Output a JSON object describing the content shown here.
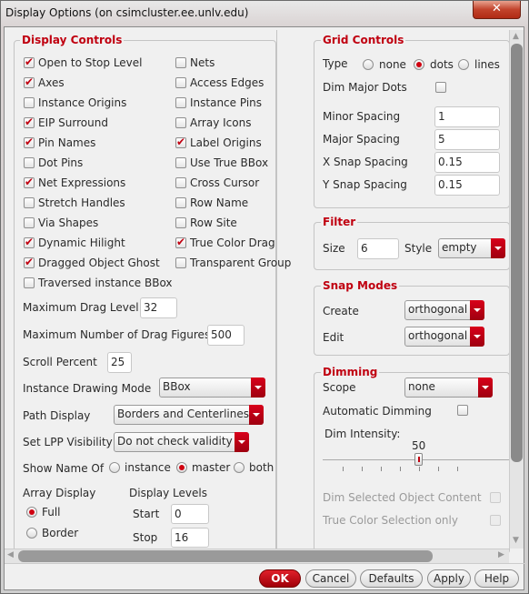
{
  "window": {
    "title": "Display Options (on csimcluster.ee.unlv.edu)",
    "close_icon": "close-icon"
  },
  "display_controls": {
    "title": "Display Controls",
    "left": [
      {
        "label": "Open to Stop Level",
        "checked": true
      },
      {
        "label": "Axes",
        "checked": true
      },
      {
        "label": "Instance Origins",
        "checked": false
      },
      {
        "label": "EIP Surround",
        "checked": true
      },
      {
        "label": "Pin Names",
        "checked": true
      },
      {
        "label": "Dot Pins",
        "checked": false
      },
      {
        "label": "Net Expressions",
        "checked": true
      },
      {
        "label": "Stretch Handles",
        "checked": false
      },
      {
        "label": "Via Shapes",
        "checked": false
      },
      {
        "label": "Dynamic Hilight",
        "checked": true
      },
      {
        "label": "Dragged Object Ghost",
        "checked": true
      },
      {
        "label": "Traversed instance BBox",
        "checked": false
      }
    ],
    "right": [
      {
        "label": "Nets",
        "checked": false
      },
      {
        "label": "Access Edges",
        "checked": false
      },
      {
        "label": "Instance Pins",
        "checked": false
      },
      {
        "label": "Array Icons",
        "checked": false
      },
      {
        "label": "Label Origins",
        "checked": true
      },
      {
        "label": "Use True BBox",
        "checked": false
      },
      {
        "label": "Cross Cursor",
        "checked": false
      },
      {
        "label": "Row Name",
        "checked": false
      },
      {
        "label": "Row Site",
        "checked": false
      },
      {
        "label": "True Color Drag",
        "checked": true
      },
      {
        "label": "Transparent Group",
        "checked": false
      }
    ],
    "max_drag_level": {
      "label": "Maximum Drag Level",
      "value": "32"
    },
    "max_drag_figures": {
      "label": "Maximum Number of Drag Figures",
      "value": "500"
    },
    "scroll_percent": {
      "label": "Scroll Percent",
      "value": "25"
    },
    "instance_drawing_mode": {
      "label": "Instance Drawing Mode",
      "value": "BBox"
    },
    "path_display": {
      "label": "Path Display",
      "value": "Borders and Centerlines"
    },
    "lpp_visibility": {
      "label": "Set LPP Visibility",
      "value": "Do not check validity"
    },
    "show_name_of": {
      "label": "Show Name Of",
      "options": [
        "instance",
        "master",
        "both"
      ],
      "selected": "master"
    },
    "array_display": {
      "label": "Array Display",
      "options": [
        "Full",
        "Border"
      ],
      "selected": "Full"
    },
    "display_levels": {
      "label": "Display Levels",
      "start_label": "Start",
      "start": "0",
      "stop_label": "Stop",
      "stop": "16"
    }
  },
  "grid_controls": {
    "title": "Grid Controls",
    "type_label": "Type",
    "type_options": [
      "none",
      "dots",
      "lines"
    ],
    "type_selected": "dots",
    "dim_major_dots": {
      "label": "Dim Major Dots",
      "checked": false
    },
    "minor_spacing": {
      "label": "Minor Spacing",
      "value": "1"
    },
    "major_spacing": {
      "label": "Major Spacing",
      "value": "5"
    },
    "x_snap": {
      "label": "X Snap Spacing",
      "value": "0.15"
    },
    "y_snap": {
      "label": "Y Snap Spacing",
      "value": "0.15"
    }
  },
  "filter": {
    "title": "Filter",
    "size_label": "Size",
    "size": "6",
    "style_label": "Style",
    "style": "empty"
  },
  "snap_modes": {
    "title": "Snap Modes",
    "create_label": "Create",
    "create": "orthogonal",
    "edit_label": "Edit",
    "edit": "orthogonal"
  },
  "dimming": {
    "title": "Dimming",
    "scope_label": "Scope",
    "scope": "none",
    "auto_label": "Automatic Dimming",
    "auto": false,
    "intensity_label": "Dim Intensity:",
    "intensity": "50",
    "dim_selected_label": "Dim Selected Object Content",
    "true_color_label": "True Color Selection only"
  },
  "buttons": {
    "ok": "OK",
    "cancel": "Cancel",
    "defaults": "Defaults",
    "apply": "Apply",
    "help": "Help"
  },
  "colors": {
    "accent": "#c00010"
  }
}
